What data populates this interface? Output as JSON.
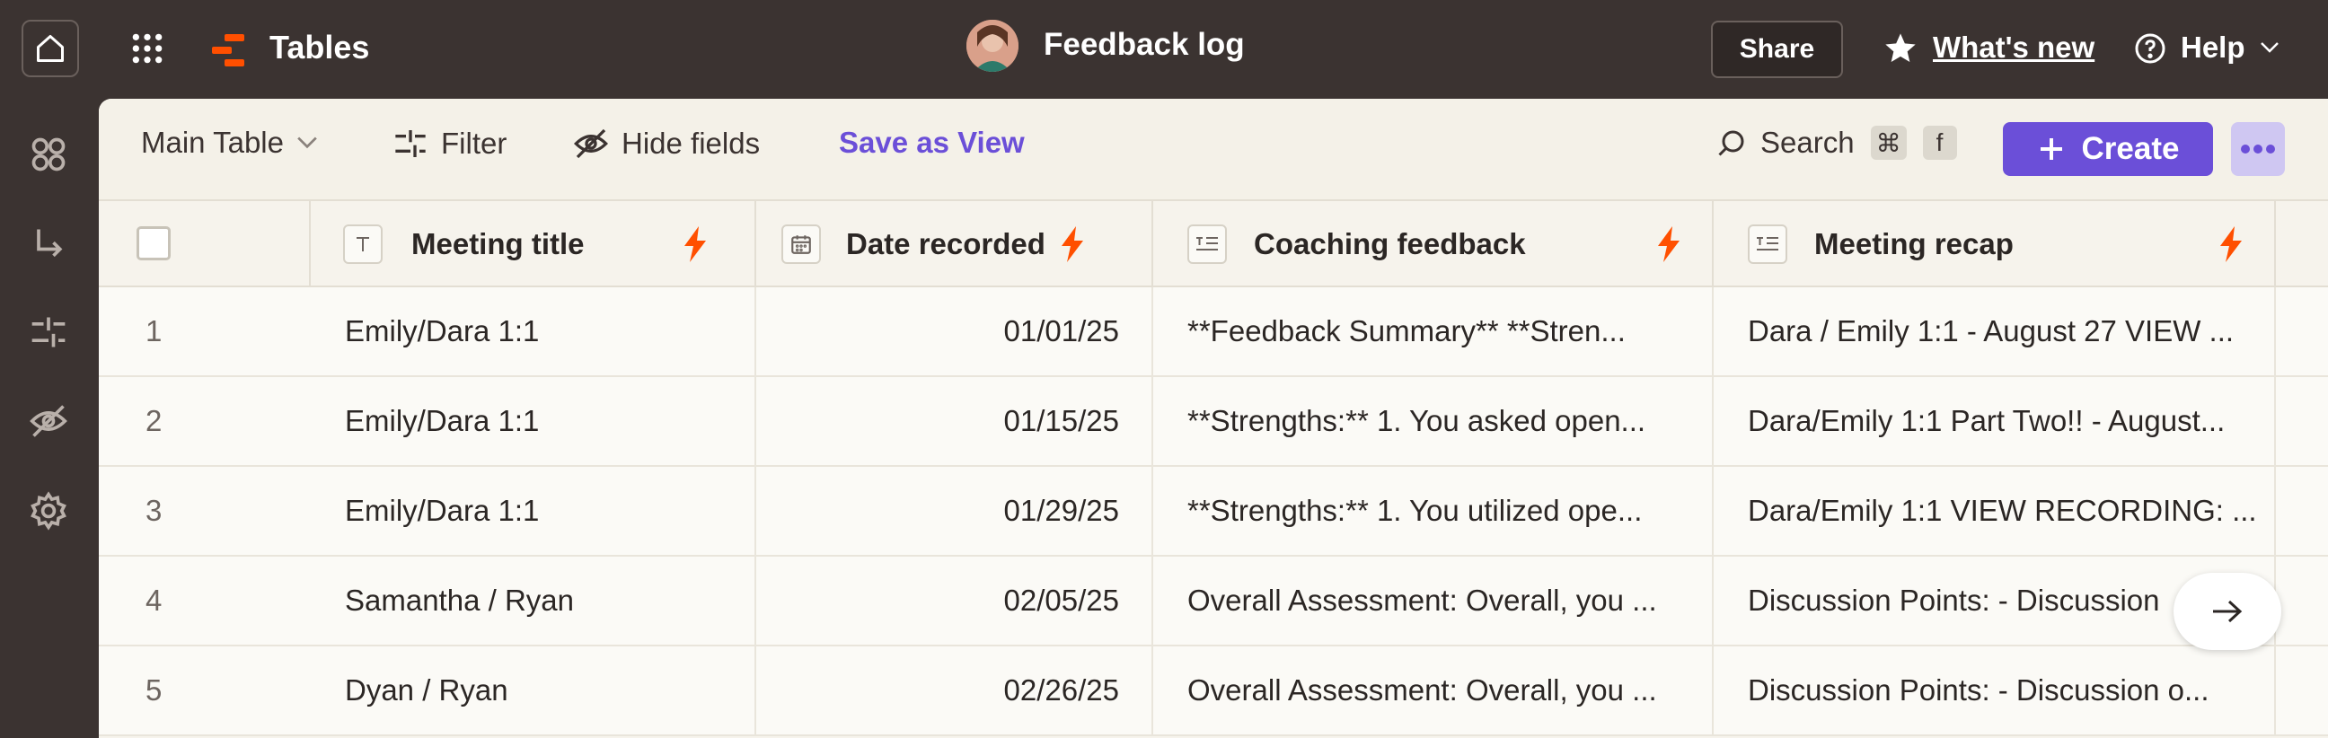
{
  "app": {
    "name": "Tables",
    "doc_title": "Feedback log"
  },
  "topbar": {
    "share_label": "Share",
    "whats_new_label": "What's new",
    "help_label": "Help"
  },
  "toolbar": {
    "view_label": "Main Table",
    "filter_label": "Filter",
    "hide_fields_label": "Hide fields",
    "save_view_label": "Save as View",
    "search_label": "Search",
    "search_shortcut_mod": "⌘",
    "search_shortcut_key": "f",
    "create_label": "Create"
  },
  "table": {
    "columns": [
      {
        "label": "Meeting title",
        "type_icon": "text-field-icon"
      },
      {
        "label": "Date recorded",
        "type_icon": "calendar-field-icon"
      },
      {
        "label": "Coaching feedback",
        "type_icon": "long-text-field-icon"
      },
      {
        "label": "Meeting recap",
        "type_icon": "long-text-field-icon"
      }
    ],
    "rows": [
      {
        "num": "1",
        "title": "Emily/Dara 1:1",
        "date": "01/01/25",
        "coaching": "**Feedback Summary** **Stren...",
        "recap": "Dara / Emily 1:1 - August 27 VIEW ..."
      },
      {
        "num": "2",
        "title": "Emily/Dara 1:1",
        "date": "01/15/25",
        "coaching": "**Strengths:** 1. You asked open...",
        "recap": "Dara/Emily 1:1 Part Two!! - August..."
      },
      {
        "num": "3",
        "title": "Emily/Dara 1:1",
        "date": "01/29/25",
        "coaching": "**Strengths:** 1. You utilized ope...",
        "recap": "Dara/Emily 1:1 VIEW RECORDING: ..."
      },
      {
        "num": "4",
        "title": "Samantha / Ryan",
        "date": "02/05/25",
        "coaching": "Overall Assessment: Overall, you ...",
        "recap": "Discussion Points: - Discussion"
      },
      {
        "num": "5",
        "title": "Dyan / Ryan",
        "date": "02/26/25",
        "coaching": "Overall Assessment: Overall, you ...",
        "recap": "Discussion Points: - Discussion o..."
      }
    ]
  },
  "colors": {
    "accent": "#6b4fd8",
    "brand": "#ff4f00",
    "bolt": "#ff4f00",
    "topbar_bg": "#3b3331"
  }
}
